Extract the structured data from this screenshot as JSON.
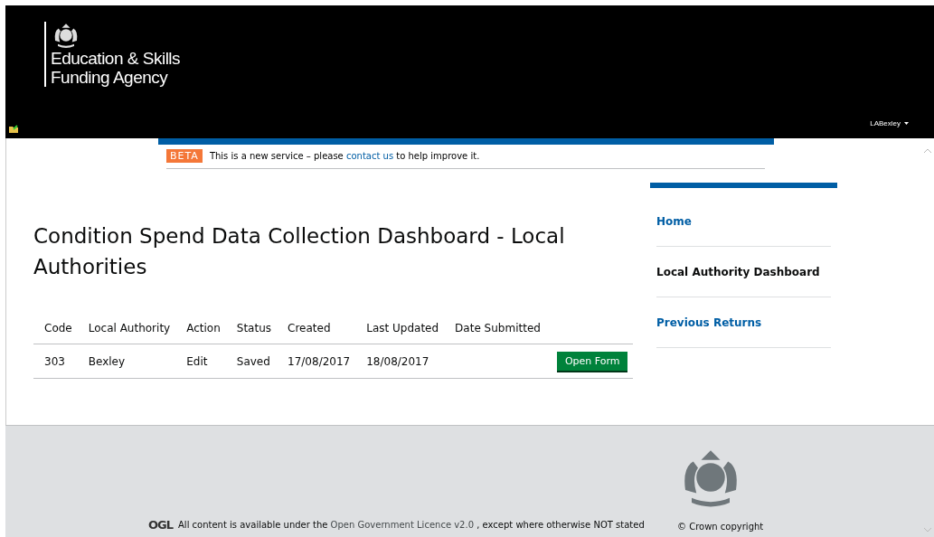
{
  "header": {
    "logo_lines": [
      "Education & Skills",
      "Funding Agency"
    ],
    "user_menu": "LABexley"
  },
  "beta_banner": {
    "tag": "BETA",
    "text_before": "This is a new service – please ",
    "link": "contact us",
    "text_after": " to help improve it."
  },
  "title": "Condition Spend Data Collection Dashboard - Local Authorities",
  "table": {
    "columns": [
      "Code",
      "Local Authority",
      "Action",
      "Status",
      "Created",
      "Last Updated",
      "Date Submitted"
    ],
    "rows": [
      {
        "cells": [
          "303",
          "Bexley",
          "Edit",
          "Saved",
          "17/08/2017",
          "18/08/2017",
          ""
        ],
        "button": "Open Form"
      }
    ]
  },
  "sidebar": {
    "items": [
      {
        "label": "Home",
        "selected": false
      },
      {
        "label": "Local Authority Dashboard",
        "selected": true
      },
      {
        "label": "Previous Returns",
        "selected": false
      }
    ]
  },
  "footer": {
    "ogl": "OGL",
    "licence_before": "All content is available under the ",
    "licence_link": "Open Government Licence v2.0",
    "licence_after": " , except where otherwise NOT stated",
    "copyright": "© Crown copyright"
  }
}
